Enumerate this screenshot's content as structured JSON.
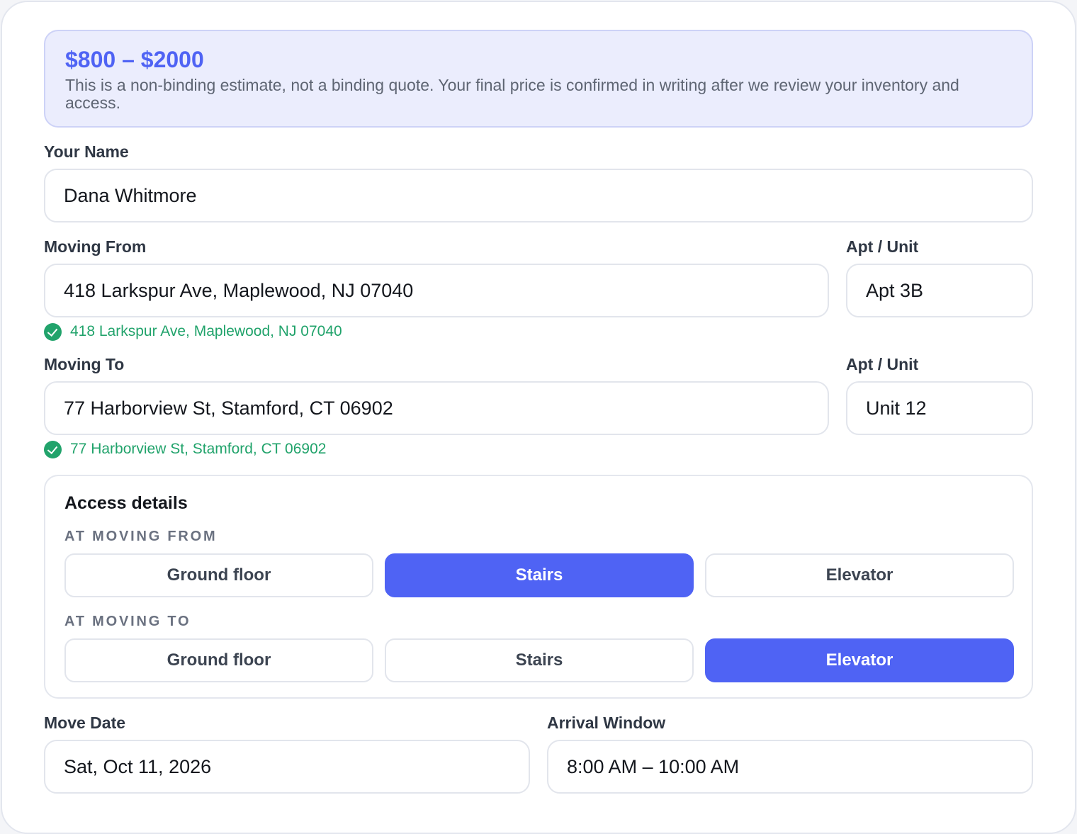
{
  "estimate": {
    "range": "$800 – $2000",
    "note": "This is a non-binding estimate, not a binding quote. Your final price is confirmed in writing after we review your inventory and access."
  },
  "name": {
    "label": "Your Name",
    "value": "Dana Whitmore"
  },
  "moving_from": {
    "label": "Moving From",
    "value": "418 Larkspur Ave, Maplewood, NJ 07040",
    "verified": "418 Larkspur Ave, Maplewood, NJ 07040",
    "unit_label": "Apt / Unit",
    "unit_value": "Apt 3B"
  },
  "moving_to": {
    "label": "Moving To",
    "value": "77 Harborview St, Stamford, CT 06902",
    "verified": "77 Harborview St, Stamford, CT 06902",
    "unit_label": "Apt / Unit",
    "unit_value": "Unit 12"
  },
  "access": {
    "title": "Access details",
    "from": {
      "caption": "AT MOVING FROM",
      "options": [
        "Ground floor",
        "Stairs",
        "Elevator"
      ],
      "selected": "Stairs"
    },
    "to": {
      "caption": "AT MOVING TO",
      "options": [
        "Ground floor",
        "Stairs",
        "Elevator"
      ],
      "selected": "Elevator"
    }
  },
  "move_date": {
    "label": "Move Date",
    "value": "Sat, Oct 11, 2026"
  },
  "arrival_window": {
    "label": "Arrival Window",
    "value": "8:00 AM – 10:00 AM"
  },
  "colors": {
    "accent": "#4f63f4",
    "success": "#21a36b",
    "estimate_bg": "#ebedfd"
  }
}
